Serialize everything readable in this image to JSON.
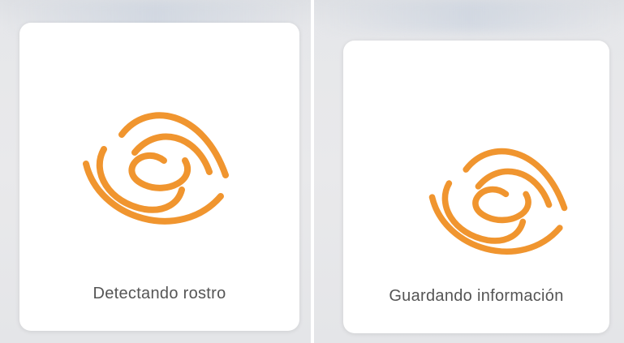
{
  "colors": {
    "accent": "#f0952f",
    "card_background": "#ffffff",
    "text": "#555555",
    "backdrop": "#e7e8eb"
  },
  "panels": [
    {
      "icon": "orange-swirl-face-scan-logo-icon",
      "status": "Detectando rostro"
    },
    {
      "icon": "orange-swirl-face-scan-logo-icon",
      "status": "Guardando información"
    }
  ]
}
